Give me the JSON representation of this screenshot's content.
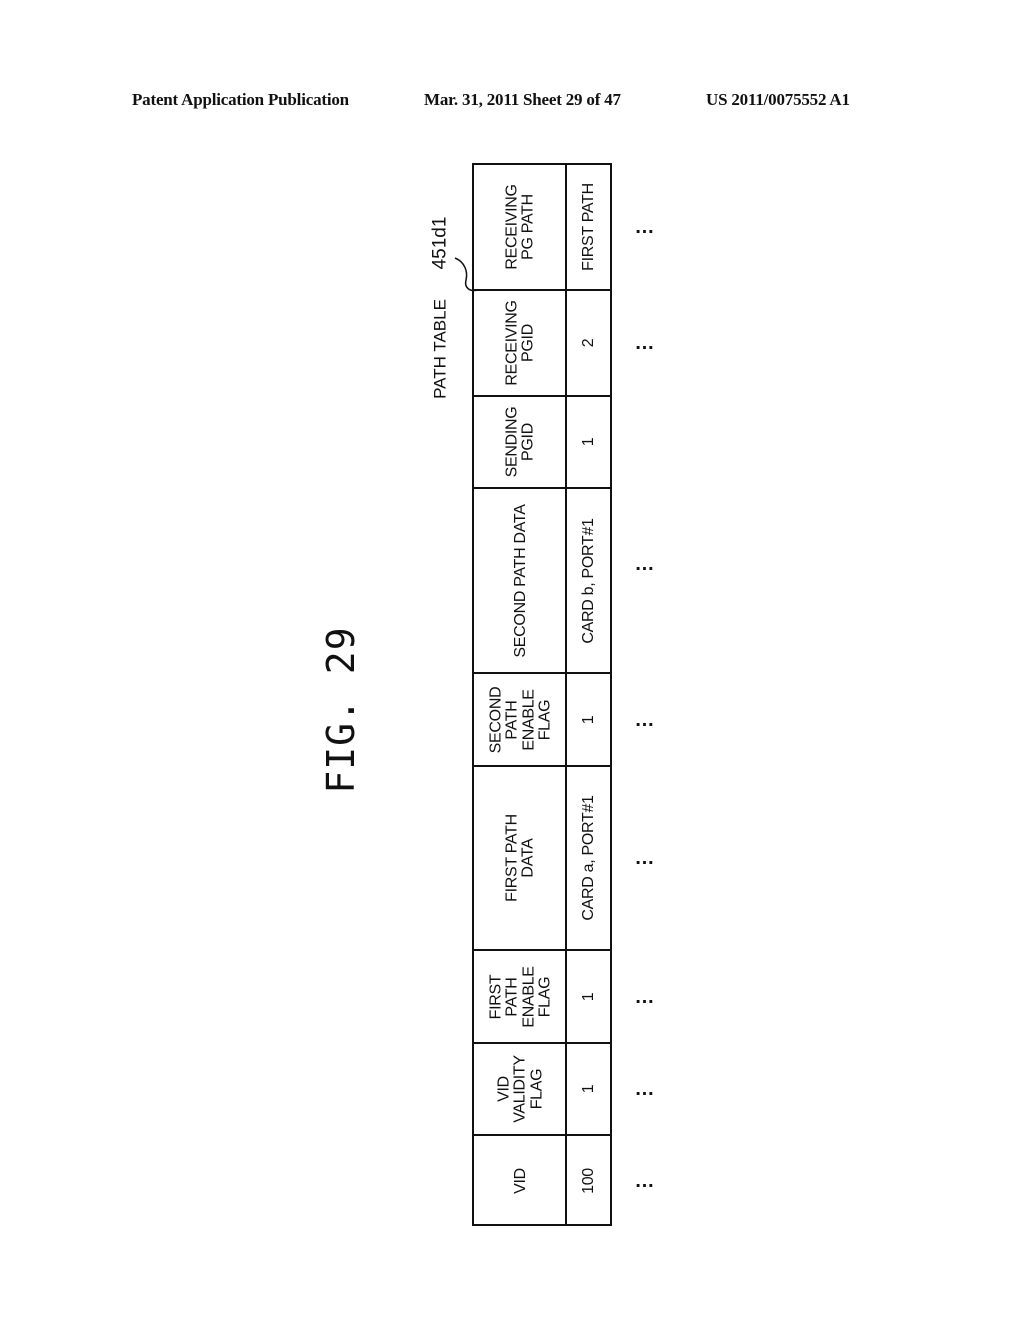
{
  "header": {
    "publication": "Patent Application Publication",
    "date_sheet": "Mar. 31, 2011  Sheet 29 of 47",
    "patent_number": "US 2011/0075552 A1"
  },
  "figure": {
    "title": "FIG. 29",
    "table_label": "PATH TABLE",
    "reference_numeral": "451d1"
  },
  "table": {
    "columns": [
      {
        "header": [
          "VID"
        ],
        "value": "100"
      },
      {
        "header": [
          "VID",
          "VALIDITY",
          "FLAG"
        ],
        "value": "1"
      },
      {
        "header": [
          "FIRST",
          "PATH",
          "ENABLE",
          "FLAG"
        ],
        "value": "1"
      },
      {
        "header": [
          "FIRST PATH",
          "DATA"
        ],
        "value": "CARD a, PORT#1"
      },
      {
        "header": [
          "SECOND",
          "PATH",
          "ENABLE",
          "FLAG"
        ],
        "value": "1"
      },
      {
        "header": [
          "SECOND PATH DATA"
        ],
        "value": "CARD b, PORT#1"
      },
      {
        "header": [
          "SENDING",
          "PGID"
        ],
        "value": "1"
      },
      {
        "header": [
          "RECEIVING",
          "PGID"
        ],
        "value": "2"
      },
      {
        "header": [
          "RECEIVING",
          "PG PATH"
        ],
        "value": "FIRST PATH"
      }
    ],
    "continuation": "…",
    "continuation_columns": [
      true,
      true,
      true,
      true,
      true,
      true,
      false,
      true,
      true
    ]
  }
}
